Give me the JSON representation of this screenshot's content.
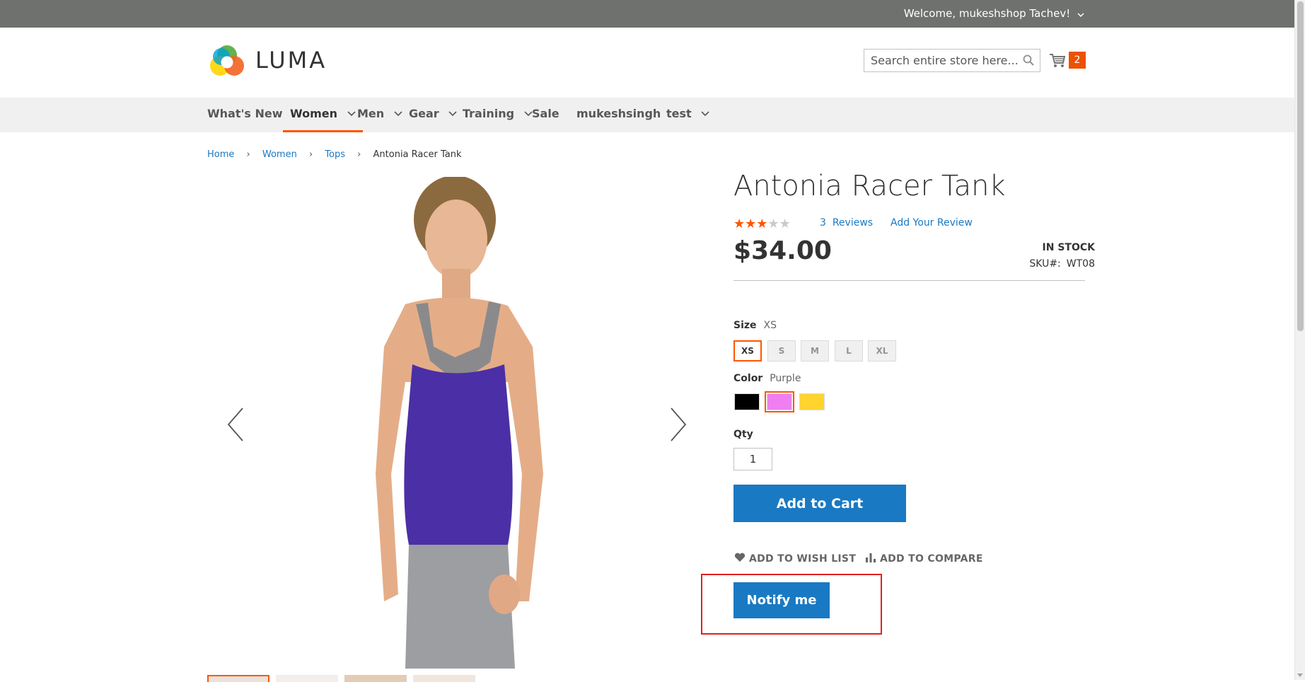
{
  "header": {
    "welcome": "Welcome, mukeshshop Tachev!",
    "logo_text": "LUMA",
    "search_placeholder": "Search entire store here...",
    "cart_count": "2"
  },
  "nav": {
    "items": [
      {
        "label": "What's New"
      },
      {
        "label": "Women"
      },
      {
        "label": "Men"
      },
      {
        "label": "Gear"
      },
      {
        "label": "Training"
      },
      {
        "label": "Sale"
      },
      {
        "label": "mukeshsingh"
      },
      {
        "label": "test"
      }
    ],
    "active": "Women"
  },
  "breadcrumb": [
    "Home",
    "Women",
    "Tops",
    "Antonia Racer Tank"
  ],
  "product": {
    "title": "Antonia Racer Tank",
    "rating": 3,
    "rating_max": 5,
    "reviews_count": "3",
    "reviews_label": "Reviews",
    "add_review_label": "Add Your Review",
    "price": "$34.00",
    "stock": "IN STOCK",
    "sku_label": "SKU#:",
    "sku": "WT08",
    "size": {
      "label": "Size",
      "selected": "XS",
      "options": [
        "XS",
        "S",
        "M",
        "L",
        "XL"
      ]
    },
    "color": {
      "label": "Color",
      "selected": "Purple",
      "options": [
        {
          "name": "Black",
          "hex": "#000000"
        },
        {
          "name": "Purple",
          "hex": "#ef7ff0"
        },
        {
          "name": "Yellow",
          "hex": "#ffd42d"
        }
      ]
    },
    "qty_label": "Qty",
    "qty": "1",
    "add_to_cart_label": "Add to Cart",
    "wishlist_label": "ADD TO WISH LIST",
    "compare_label": "ADD TO COMPARE",
    "notify_label": "Notify me"
  },
  "colors": {
    "accent": "#1979c3",
    "highlight": "#ff5501",
    "topbar": "#6e716e",
    "annotation_box": "#e02020"
  }
}
